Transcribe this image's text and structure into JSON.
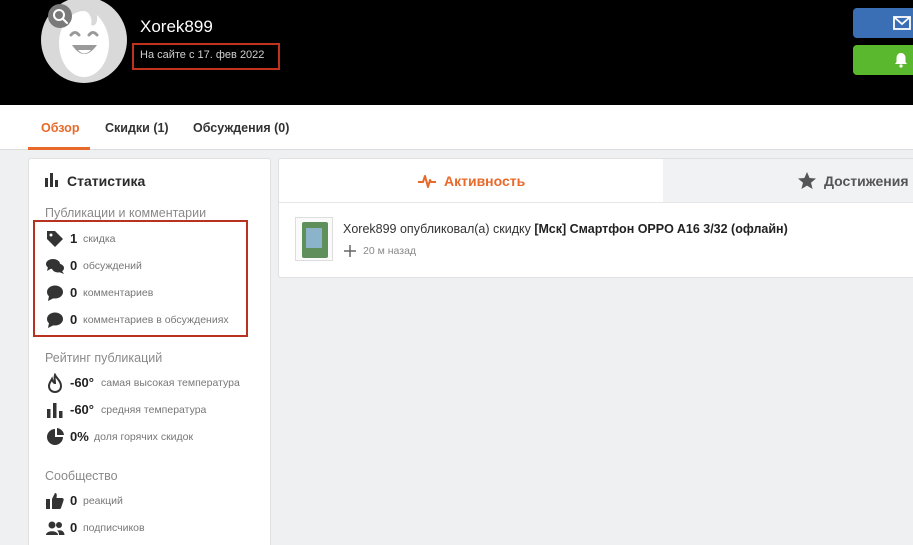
{
  "profile": {
    "username": "Xorek899",
    "member_since": "На сайте с 17. фев 2022"
  },
  "header_buttons": {
    "message_icon": "envelope-icon",
    "bell_icon": "bell-icon"
  },
  "tabs": [
    {
      "label": "Обзор",
      "active": true
    },
    {
      "label": "Скидки (1)",
      "active": false
    },
    {
      "label": "Обсуждения (0)",
      "active": false
    }
  ],
  "stats": {
    "title": "Статистика",
    "sections": {
      "publications": "Публикации и комментарии",
      "rating": "Рейтинг публикаций",
      "community": "Сообщество"
    },
    "publications": [
      {
        "icon": "tag-icon",
        "value": "1",
        "label": "скидка"
      },
      {
        "icon": "chat-bubbles-icon",
        "value": "0",
        "label": "обсуждений"
      },
      {
        "icon": "comment-icon",
        "value": "0",
        "label": "комментариев"
      },
      {
        "icon": "comment-icon",
        "value": "0",
        "label": "комментариев в обсуждениях"
      }
    ],
    "rating": [
      {
        "icon": "flame-icon",
        "value": "-60°",
        "label": "самая высокая температура"
      },
      {
        "icon": "bar-chart-icon",
        "value": "-60°",
        "label": "средняя температура"
      },
      {
        "icon": "pie-chart-icon",
        "value": "0%",
        "label": "доля горячих скидок"
      }
    ],
    "community": [
      {
        "icon": "thumbs-up-icon",
        "value": "0",
        "label": "реакций"
      },
      {
        "icon": "users-icon",
        "value": "0",
        "label": "подписчиков"
      }
    ]
  },
  "activity": {
    "tab_active": "Активность",
    "tab_other": "Достижения",
    "feed": {
      "text_prefix": "Xorek899 опубликовал(а) скидку",
      "deal_title": "[Мск] Смартфон OPPO A16 3/32 (офлайн)",
      "time": "20 м назад"
    }
  },
  "colors": {
    "accent": "#e8692a",
    "highlight_box": "#c0321d",
    "msg_button": "#3b6fb5",
    "bell_button": "#5ab82e"
  }
}
